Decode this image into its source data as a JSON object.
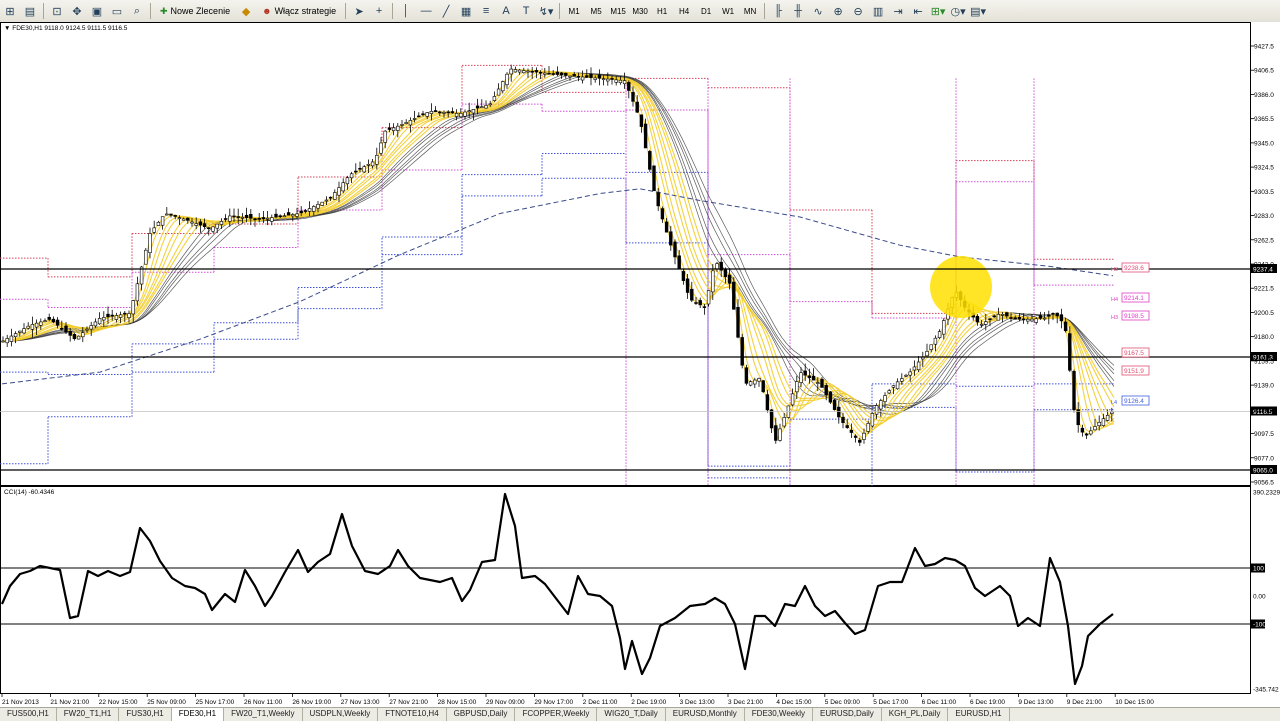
{
  "toolbar": {
    "new_order_label": "Nowe Zlecenie",
    "strategies_label": "Włącz strategie",
    "timeframes": [
      "M1",
      "M5",
      "M15",
      "M30",
      "H1",
      "H4",
      "D1",
      "W1",
      "MN"
    ]
  },
  "main_chart": {
    "title": "FDE30,H1  9118.0 9124.5 9111.5 9116.5",
    "price_ticks": [
      "9427.5",
      "9406.5",
      "9386.0",
      "9365.5",
      "9345.0",
      "9324.5",
      "9303.5",
      "9283.0",
      "9262.5",
      "9242.0",
      "9221.5",
      "9200.5",
      "9180.0",
      "9159.5",
      "9139.0",
      "9118.5",
      "9097.5",
      "9077.0",
      "9056.5"
    ],
    "hline_labels": [
      "9237.4",
      "9161.3",
      "9065.0"
    ],
    "current_price": "9116.5",
    "pivot_labels": [
      {
        "prefix": "H3",
        "value": "9238.6",
        "color": "#e0507a"
      },
      {
        "prefix": "H4",
        "value": "9214.1",
        "color": "#e040c8"
      },
      {
        "prefix": "H3",
        "value": "9198.5",
        "color": "#e040c8"
      },
      {
        "prefix": "",
        "value": "9167.5",
        "color": "#e05070"
      },
      {
        "prefix": "",
        "value": "9151.9",
        "color": "#e05070"
      },
      {
        "prefix": "L4",
        "value": "9126.4",
        "color": "#4060e0"
      }
    ]
  },
  "cci_chart": {
    "title": "CCI(14) -60.4346",
    "axis_labels": [
      "390.2329",
      "100",
      "0.00",
      "-100",
      "-345.742"
    ]
  },
  "time_axis": [
    "21 Nov 2013",
    "21 Nov 21:00",
    "22 Nov 15:00",
    "25 Nov 09:00",
    "25 Nov 17:00",
    "26 Nov 11:00",
    "26 Nov 19:00",
    "27 Nov 13:00",
    "27 Nov 21:00",
    "28 Nov 15:00",
    "29 Nov 09:00",
    "29 Nov 17:00",
    "2 Dec 11:00",
    "2 Dec 19:00",
    "3 Dec 13:00",
    "3 Dec 21:00",
    "4 Dec 15:00",
    "5 Dec 09:00",
    "5 Dec 17:00",
    "6 Dec 11:00",
    "6 Dec 19:00",
    "9 Dec 13:00",
    "9 Dec 21:00",
    "10 Dec 15:00"
  ],
  "tabs": [
    {
      "label": "FUS500,H1",
      "active": false
    },
    {
      "label": "FW20_T1,H1",
      "active": false
    },
    {
      "label": "FUS30,H1",
      "active": false
    },
    {
      "label": "FDE30,H1",
      "active": true
    },
    {
      "label": "FW20_T1,Weekly",
      "active": false
    },
    {
      "label": "USDPLN,Weekly",
      "active": false
    },
    {
      "label": "FTNOTE10,H4",
      "active": false
    },
    {
      "label": "GBPUSD,Daily",
      "active": false
    },
    {
      "label": "FCOPPER,Weekly",
      "active": false
    },
    {
      "label": "WIG20_T,Daily",
      "active": false
    },
    {
      "label": "EURUSD,Monthly",
      "active": false
    },
    {
      "label": "FDE30,Weekly",
      "active": false
    },
    {
      "label": "EURUSD,Daily",
      "active": false
    },
    {
      "label": "KGH_PL,Daily",
      "active": false
    },
    {
      "label": "EURUSD,H1",
      "active": false
    }
  ],
  "colors": {
    "ribbon": "#f2cc2a",
    "pivot_red": "#d8405a",
    "pivot_magenta": "#d050d8",
    "pivot_blue": "#4050d8",
    "ma_line": "#3a4a8a",
    "highlight": "#ffe000"
  }
}
